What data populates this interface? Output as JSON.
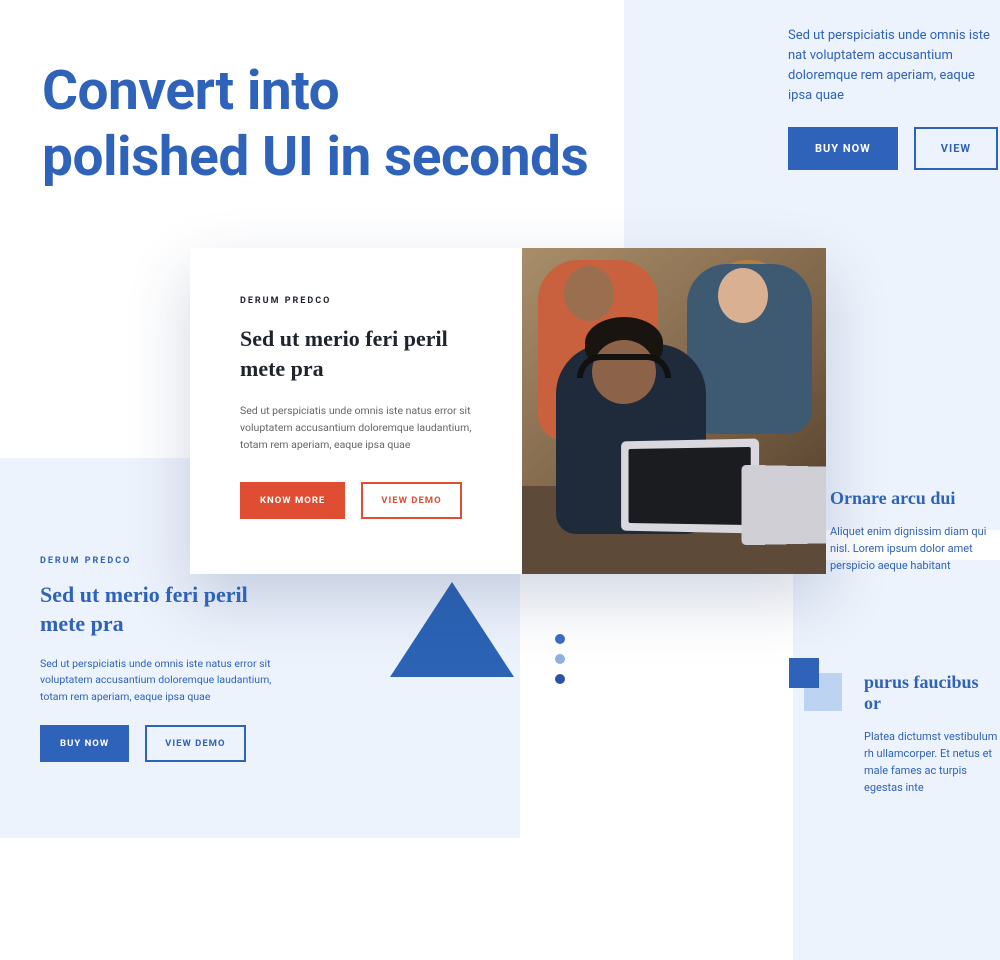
{
  "headline": "Convert into\npolished UI in seconds",
  "top_right": {
    "paragraph": "Sed ut perspiciatis unde omnis iste nat voluptatem accusantium doloremque rem aperiam, eaque ipsa quae",
    "buy_label": "BUY NOW",
    "view_label": "VIEW"
  },
  "middle": {
    "eyebrow": "DERUM PREDCO",
    "title": "Sed ut merio feri peril mete pra",
    "paragraph": "Sed ut perspiciatis unde omnis iste natus error sit voluptatem accusantium doloremque laudantium, totam rem aperiam, eaque ipsa quae",
    "know_label": "KNOW MORE",
    "view_label": "VIEW DEMO",
    "image_alt": "People working at laptops"
  },
  "bottom_left": {
    "eyebrow": "DERUM PREDCO",
    "title": "Sed ut merio feri peril mete pra",
    "paragraph": "Sed ut perspiciatis unde omnis iste natus error sit voluptatem accusantium doloremque laudantium, totam rem aperiam, eaque ipsa quae",
    "buy_label": "BUY NOW",
    "view_label": "VIEW DEMO"
  },
  "bottom_right_upper": {
    "title": "Ornare arcu dui",
    "paragraph": "Aliquet enim dignissim diam qui nisl. Lorem ipsum dolor amet perspicio aeque habitant"
  },
  "bottom_right_lower": {
    "title": "purus faucibus or",
    "paragraph": "Platea dictumst vestibulum rh ullamcorper. Et netus et male fames ac turpis egestas inte"
  },
  "colors": {
    "primary": "#2F62B9",
    "accent": "#DF4E32",
    "panel": "#EDF3FC"
  }
}
